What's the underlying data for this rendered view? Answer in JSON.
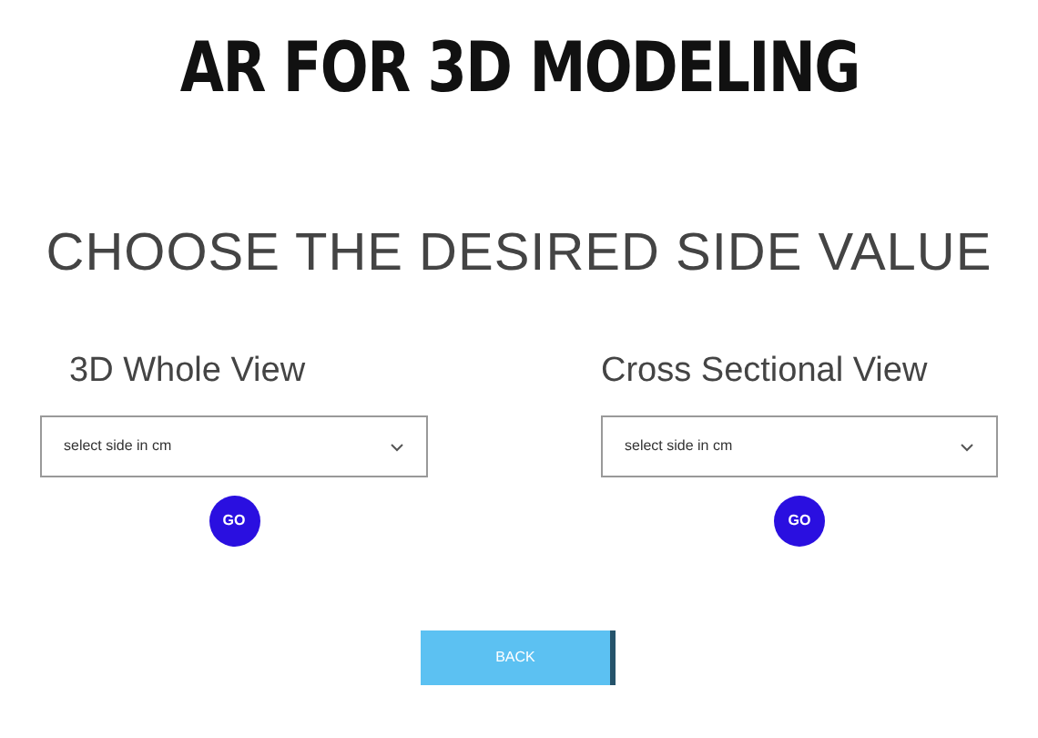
{
  "title": "AR FOR 3D MODELING",
  "subtitle": "CHOOSE THE DESIRED SIDE VALUE",
  "panels": [
    {
      "label": "3D Whole View",
      "dropdown": {
        "value": "select side in cm"
      },
      "button": "GO"
    },
    {
      "label": "Cross Sectional View",
      "dropdown": {
        "value": "select side in cm"
      },
      "button": "GO"
    }
  ],
  "back_button": "BACK"
}
